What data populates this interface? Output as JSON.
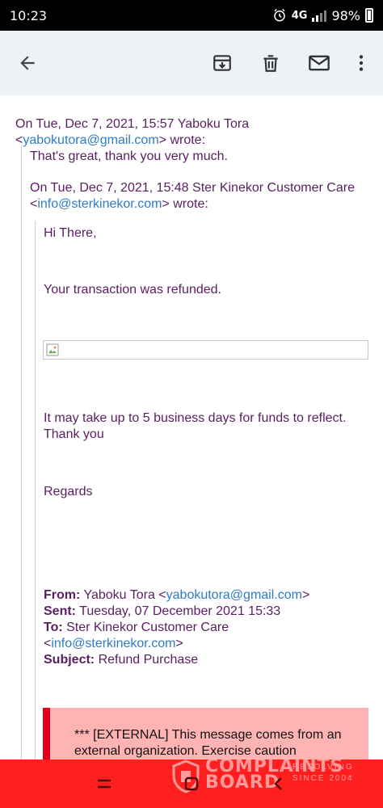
{
  "status_bar": {
    "time": "10:23",
    "network": "4G",
    "battery": "98%"
  },
  "app_bar": {
    "icons": [
      "back-arrow-icon",
      "archive-icon",
      "delete-icon",
      "mark-unread-icon",
      "more-options-icon"
    ]
  },
  "email": {
    "quote1_header_line1": "On Tue, Dec 7, 2021, 15:57 Yaboku Tora",
    "quote1_email": "yabokutora@gmail.com",
    "quote1_lt": "<",
    "quote1_wrote": "> wrote:",
    "quote1_body": "That's great, thank you very much.",
    "quote2_header_line1": "On Tue, Dec 7, 2021, 15:48 Ster Kinekor Customer Care",
    "quote2_lt": "<",
    "quote2_email": "info@sterkinekor.com",
    "quote2_wrote": "> wrote:",
    "greeting": "Hi There,",
    "refund_line": "Your transaction was refunded.",
    "funds_line": "It may take up to 5 business days for funds to reflect.",
    "thanks_line": "Thank you",
    "regards_line": "Regards",
    "from_label": "From:",
    "from_name": " Yaboku Tora <",
    "from_email": "yabokutora@gmail.com",
    "from_close": ">",
    "sent_label": "Sent:",
    "sent_value": " Tuesday, 07 December 2021 15:33",
    "to_label": "To:",
    "to_value": " Ster Kinekor Customer Care",
    "to_lt": "<",
    "to_email": "info@sterkinekor.com",
    "to_close": ">",
    "subject_label": "Subject:",
    "subject_value": " Refund Purchase",
    "external_warning": "*** [EXTERNAL] This message comes from an external organization. Exercise caution"
  },
  "watermark": {
    "word1": "COMPLAINTS",
    "word2": "BOARD",
    "tag1": "RESOLVING",
    "tag2": "SINCE 2004"
  },
  "colors": {
    "text": "#5a1d62",
    "link": "#2d7cc4",
    "app_bar_bg": "#eef1f6",
    "bottom_bar": "#ff1f1f",
    "warning_bg": "#ffb3b3",
    "warning_border": "#e3001b"
  }
}
